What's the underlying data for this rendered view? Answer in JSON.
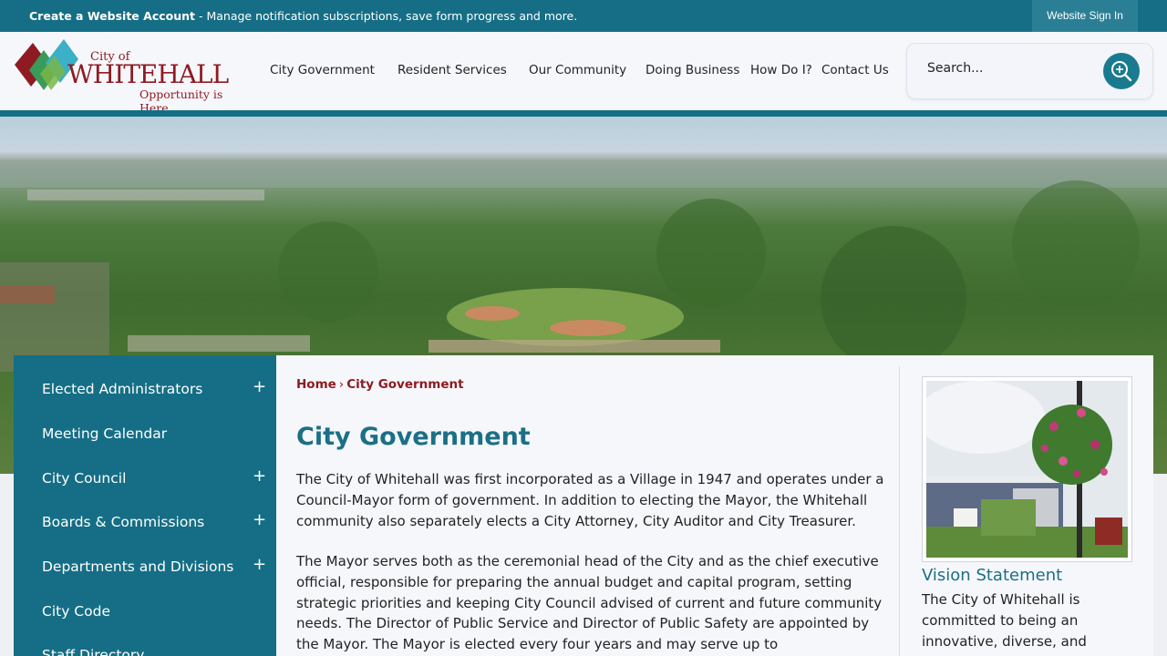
{
  "topbar": {
    "account_link": "Create a Website Account",
    "account_desc": " - Manage notification subscriptions, save form progress and more.",
    "sign_in": "Website Sign In"
  },
  "logo": {
    "city_of": "City of",
    "name": "WHITEHALL",
    "tagline": "Opportunity is Here"
  },
  "nav": {
    "items": [
      {
        "label": "City Government"
      },
      {
        "label": "Resident Services"
      },
      {
        "label": "Our Community"
      },
      {
        "label": "Doing Business"
      },
      {
        "label": "How Do I?"
      },
      {
        "label": "Contact Us"
      }
    ]
  },
  "search": {
    "placeholder": "Search...",
    "icon": "search-icon"
  },
  "sidebar": {
    "items": [
      {
        "label": "Elected Administrators",
        "expandable": true
      },
      {
        "label": "Meeting Calendar",
        "expandable": false
      },
      {
        "label": "City Council",
        "expandable": true
      },
      {
        "label": "Boards & Commissions",
        "expandable": true
      },
      {
        "label": "Departments and Divisions",
        "expandable": true
      },
      {
        "label": "City Code",
        "expandable": false
      },
      {
        "label": "Staff Directory",
        "expandable": false
      }
    ],
    "expand_glyph": "+"
  },
  "breadcrumb": {
    "home": "Home",
    "separator": "›",
    "current": "City Government"
  },
  "main": {
    "title": "City Government",
    "paragraphs": [
      "The City of Whitehall was first incorporated as a Village in 1947 and operates under a Council-Mayor form of government. In addition to electing the Mayor, the Whitehall community also separately elects a City Attorney, City Auditor and City Treasurer.",
      "The Mayor serves both as the ceremonial head of the City and as the chief executive official, responsible for preparing the annual budget and capital program, setting strategic priorities and keeping City Council advised of current and future community needs. The Director of Public Service and Director of Public Safety are appointed by the Mayor. The Mayor is elected every four years and may serve up to"
    ]
  },
  "aside": {
    "vision_title": "Vision Statement",
    "vision_text": "The City of Whitehall is committed to being an innovative, diverse, and"
  },
  "colors": {
    "teal": "#156e85",
    "maroon": "#8e1b22",
    "heading_teal": "#1b6f86"
  }
}
